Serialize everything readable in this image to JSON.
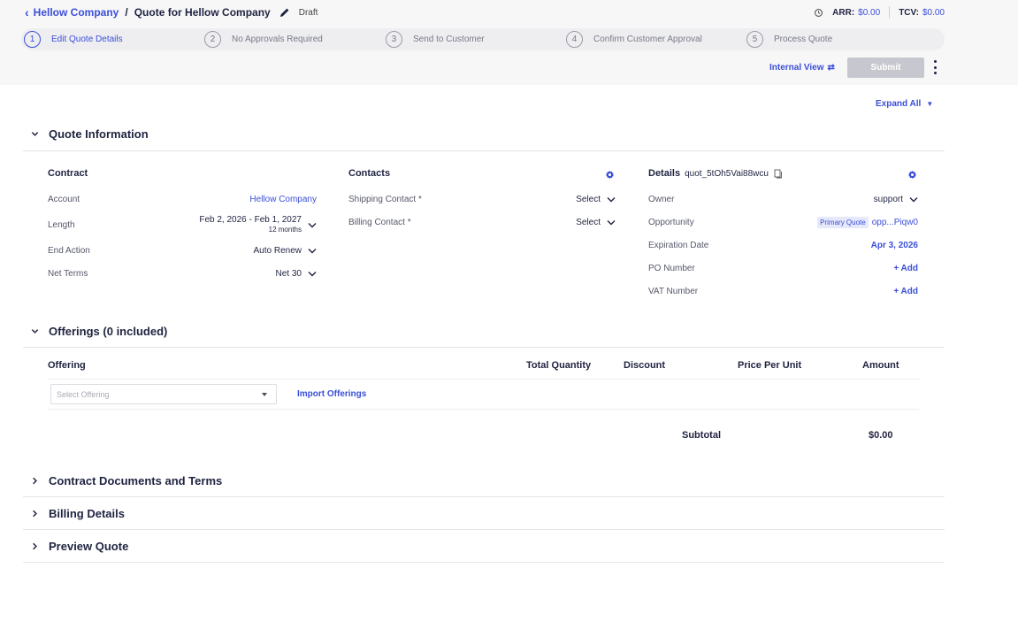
{
  "breadcrumb": {
    "company": "Hellow Company",
    "separator": "/",
    "title": "Quote for Hellow Company",
    "status": "Draft"
  },
  "metrics": {
    "arr_label": "ARR:",
    "arr_value": "$0.00",
    "tcv_label": "TCV:",
    "tcv_value": "$0.00"
  },
  "steps": [
    {
      "num": "1",
      "label": "Edit Quote Details"
    },
    {
      "num": "2",
      "label": "No Approvals Required"
    },
    {
      "num": "3",
      "label": "Send to Customer"
    },
    {
      "num": "4",
      "label": "Confirm Customer Approval"
    },
    {
      "num": "5",
      "label": "Process Quote"
    }
  ],
  "toolbar": {
    "internal_view": "Internal View",
    "submit": "Submit",
    "expand_all": "Expand All"
  },
  "quote_info": {
    "title": "Quote Information",
    "contract": {
      "title": "Contract",
      "account_label": "Account",
      "account_value": "Hellow Company",
      "length_label": "Length",
      "length_value": "Feb 2, 2026 - Feb 1, 2027",
      "length_sub": "12 months",
      "end_action_label": "End Action",
      "end_action_value": "Auto Renew",
      "net_terms_label": "Net Terms",
      "net_terms_value": "Net 30"
    },
    "contacts": {
      "title": "Contacts",
      "shipping_label": "Shipping Contact *",
      "shipping_value": "Select",
      "billing_label": "Billing Contact *",
      "billing_value": "Select"
    },
    "details": {
      "title": "Details",
      "quote_id": "quot_5tOh5Vai88wcu",
      "owner_label": "Owner",
      "owner_value": "support",
      "opportunity_label": "Opportunity",
      "opportunity_badge": "Primary Quote",
      "opportunity_value": "opp...Piqw0",
      "expiration_label": "Expiration Date",
      "expiration_value": "Apr 3, 2026",
      "po_label": "PO Number",
      "po_value": "+ Add",
      "vat_label": "VAT Number",
      "vat_value": "+ Add"
    }
  },
  "offerings": {
    "title": "Offerings (0 included)",
    "columns": [
      "Offering",
      "Total Quantity",
      "Discount",
      "Price Per Unit",
      "Amount"
    ],
    "select_placeholder": "Select Offering",
    "import": "Import Offerings",
    "subtotal_label": "Subtotal",
    "subtotal_value": "$0.00"
  },
  "sections": [
    {
      "title": "Contract Documents and Terms"
    },
    {
      "title": "Billing Details"
    },
    {
      "title": "Preview Quote"
    }
  ],
  "colors": {
    "accent": "#3b4fd8",
    "text": "#1f2340",
    "submit_disabled": "#c7c7cf"
  }
}
